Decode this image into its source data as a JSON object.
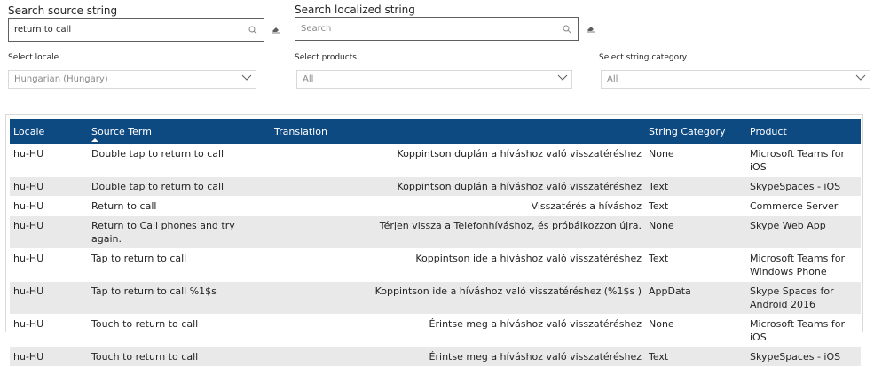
{
  "filters": {
    "source_label": "Search source string",
    "source_value": "return to call",
    "localized_label": "Search localized string",
    "localized_placeholder": "Search",
    "locale_label": "Select locale",
    "locale_value": "Hungarian (Hungary)",
    "products_label": "Select products",
    "products_value": "All",
    "category_label": "Select string category",
    "category_value": "All"
  },
  "table": {
    "headers": [
      "Locale",
      "Source Term",
      "Translation",
      "String Category",
      "Product"
    ],
    "rows": [
      {
        "locale": "hu-HU",
        "source": "Double tap to return to call",
        "translation": "Koppintson duplán a híváshoz való visszatéréshez",
        "category": "None",
        "product": "Microsoft Teams for iOS"
      },
      {
        "locale": "hu-HU",
        "source": "Double tap to return to call",
        "translation": "Koppintson duplán a híváshoz való visszatéréshez",
        "category": "Text",
        "product": "SkypeSpaces - iOS"
      },
      {
        "locale": "hu-HU",
        "source": "Return to call",
        "translation": "Visszatérés a híváshoz",
        "category": "Text",
        "product": "Commerce Server"
      },
      {
        "locale": "hu-HU",
        "source": "Return to Call phones and try again.",
        "translation": "Térjen vissza a Telefonhíváshoz, és próbálkozzon újra.",
        "category": "None",
        "product": "Skype Web App"
      },
      {
        "locale": "hu-HU",
        "source": "Tap to return to call",
        "translation": "Koppintson ide a híváshoz való visszatéréshez",
        "category": "Text",
        "product": "Microsoft Teams for Windows Phone"
      },
      {
        "locale": "hu-HU",
        "source": "Tap to return to call %1$s",
        "translation": "Koppintson ide a híváshoz való visszatéréshez (%1$s )",
        "category": "AppData",
        "product": "Skype Spaces for Android 2016"
      },
      {
        "locale": "hu-HU",
        "source": "Touch to return to call",
        "translation": "Érintse meg a híváshoz való visszatéréshez",
        "category": "None",
        "product": "Microsoft Teams for iOS"
      },
      {
        "locale": "hu-HU",
        "source": "Touch to return to call",
        "translation": "Érintse meg a híváshoz való visszatéréshez",
        "category": "Text",
        "product": "SkypeSpaces - iOS"
      }
    ]
  }
}
